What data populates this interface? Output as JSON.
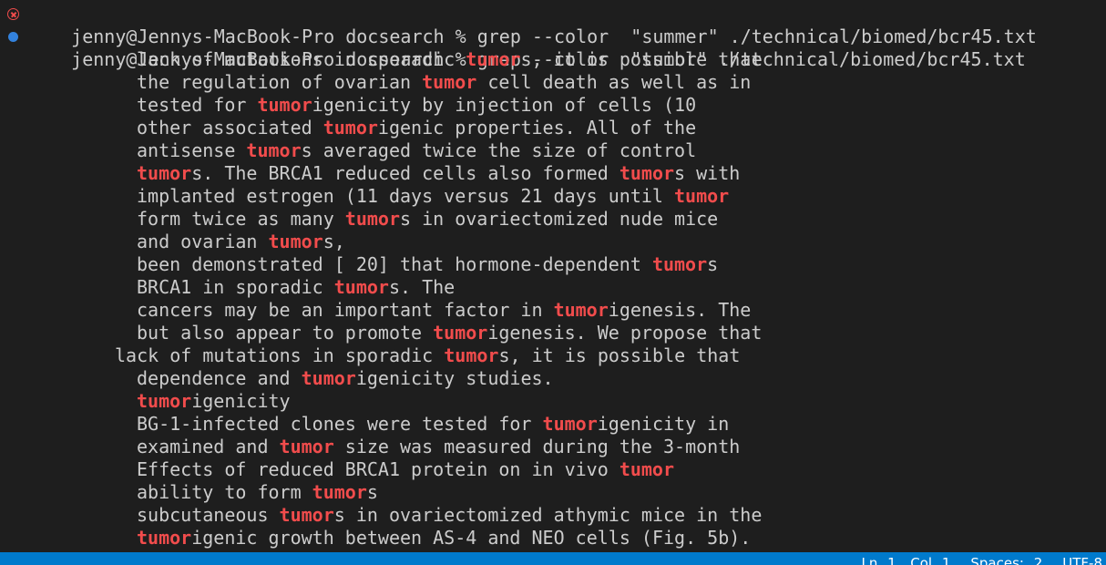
{
  "terminal": {
    "commands": [
      {
        "status": "error",
        "prompt": "jenny@Jennys-MacBook-Pro docsearch % ",
        "command": "grep --color  \"summer\" ./technical/biomed/bcr45.txt"
      },
      {
        "status": "success",
        "prompt": "jenny@Jennys-MacBook-Pro docsearch % ",
        "command": "grep --color  \"tumor\" ./technical/biomed/bcr45.txt"
      }
    ],
    "output_lines": [
      {
        "indent": "normal",
        "parts": [
          {
            "t": "lack of mutations in sporadic "
          },
          {
            "t": "tumor",
            "m": true
          },
          {
            "t": "s, it is possible that"
          }
        ]
      },
      {
        "indent": "normal",
        "parts": [
          {
            "t": "the regulation of ovarian "
          },
          {
            "t": "tumor",
            "m": true
          },
          {
            "t": " cell death as well as in"
          }
        ]
      },
      {
        "indent": "normal",
        "parts": [
          {
            "t": "tested for "
          },
          {
            "t": "tumor",
            "m": true
          },
          {
            "t": "igenicity by injection of cells (10"
          }
        ]
      },
      {
        "indent": "normal",
        "parts": [
          {
            "t": "other associated "
          },
          {
            "t": "tumor",
            "m": true
          },
          {
            "t": "igenic properties. All of the"
          }
        ]
      },
      {
        "indent": "normal",
        "parts": [
          {
            "t": "antisense "
          },
          {
            "t": "tumor",
            "m": true
          },
          {
            "t": "s averaged twice the size of control"
          }
        ]
      },
      {
        "indent": "normal",
        "parts": [
          {
            "t": "tumor",
            "m": true
          },
          {
            "t": "s. The BRCA1 reduced cells also formed "
          },
          {
            "t": "tumor",
            "m": true
          },
          {
            "t": "s with"
          }
        ]
      },
      {
        "indent": "normal",
        "parts": [
          {
            "t": "implanted estrogen (11 days versus 21 days until "
          },
          {
            "t": "tumor",
            "m": true
          }
        ]
      },
      {
        "indent": "normal",
        "parts": [
          {
            "t": "form twice as many "
          },
          {
            "t": "tumor",
            "m": true
          },
          {
            "t": "s in ovariectomized nude mice"
          }
        ]
      },
      {
        "indent": "normal",
        "parts": [
          {
            "t": "and ovarian "
          },
          {
            "t": "tumor",
            "m": true
          },
          {
            "t": "s,"
          }
        ]
      },
      {
        "indent": "normal",
        "parts": [
          {
            "t": "been demonstrated [ 20] that hormone-dependent "
          },
          {
            "t": "tumor",
            "m": true
          },
          {
            "t": "s"
          }
        ]
      },
      {
        "indent": "normal",
        "parts": [
          {
            "t": "BRCA1 in sporadic "
          },
          {
            "t": "tumor",
            "m": true
          },
          {
            "t": "s. The"
          }
        ]
      },
      {
        "indent": "normal",
        "parts": [
          {
            "t": "cancers may be an important factor in "
          },
          {
            "t": "tumor",
            "m": true
          },
          {
            "t": "igenesis. The"
          }
        ]
      },
      {
        "indent": "normal",
        "parts": [
          {
            "t": "but also appear to promote "
          },
          {
            "t": "tumor",
            "m": true
          },
          {
            "t": "igenesis. We propose that"
          }
        ]
      },
      {
        "indent": "shift",
        "parts": [
          {
            "t": "lack of mutations in sporadic "
          },
          {
            "t": "tumor",
            "m": true
          },
          {
            "t": "s, it is possible that"
          }
        ]
      },
      {
        "indent": "normal",
        "parts": [
          {
            "t": "dependence and "
          },
          {
            "t": "tumor",
            "m": true
          },
          {
            "t": "igenicity studies."
          }
        ]
      },
      {
        "indent": "normal",
        "parts": [
          {
            "t": "tumor",
            "m": true
          },
          {
            "t": "igenicity"
          }
        ]
      },
      {
        "indent": "normal",
        "parts": [
          {
            "t": "BG-1-infected clones were tested for "
          },
          {
            "t": "tumor",
            "m": true
          },
          {
            "t": "igenicity in"
          }
        ]
      },
      {
        "indent": "normal",
        "parts": [
          {
            "t": "examined and "
          },
          {
            "t": "tumor",
            "m": true
          },
          {
            "t": " size was measured during the 3-month"
          }
        ]
      },
      {
        "indent": "normal",
        "parts": [
          {
            "t": "Effects of reduced BRCA1 protein on in vivo "
          },
          {
            "t": "tumor",
            "m": true
          }
        ]
      },
      {
        "indent": "normal",
        "parts": [
          {
            "t": "ability to form "
          },
          {
            "t": "tumor",
            "m": true
          },
          {
            "t": "s"
          }
        ]
      },
      {
        "indent": "normal",
        "parts": [
          {
            "t": "subcutaneous "
          },
          {
            "t": "tumor",
            "m": true
          },
          {
            "t": "s in ovariectomized athymic mice in the"
          }
        ]
      },
      {
        "indent": "normal",
        "parts": [
          {
            "t": "tumor",
            "m": true
          },
          {
            "t": "igenic growth between AS-4 and NEO cells (Fig. 5b)."
          }
        ]
      }
    ]
  },
  "statusbar": {
    "items": [
      "Ln 1, Col 1",
      "Spaces: 2",
      "UTF-8"
    ]
  },
  "colors": {
    "background": "#1e1e1e",
    "text": "#cccccc",
    "match": "#f14c4c",
    "error_icon": "#f14c4c",
    "success_icon": "#3794ff",
    "statusbar": "#007acc"
  },
  "icons": {
    "error": "error-circle-x-icon",
    "success": "success-dot-icon"
  }
}
